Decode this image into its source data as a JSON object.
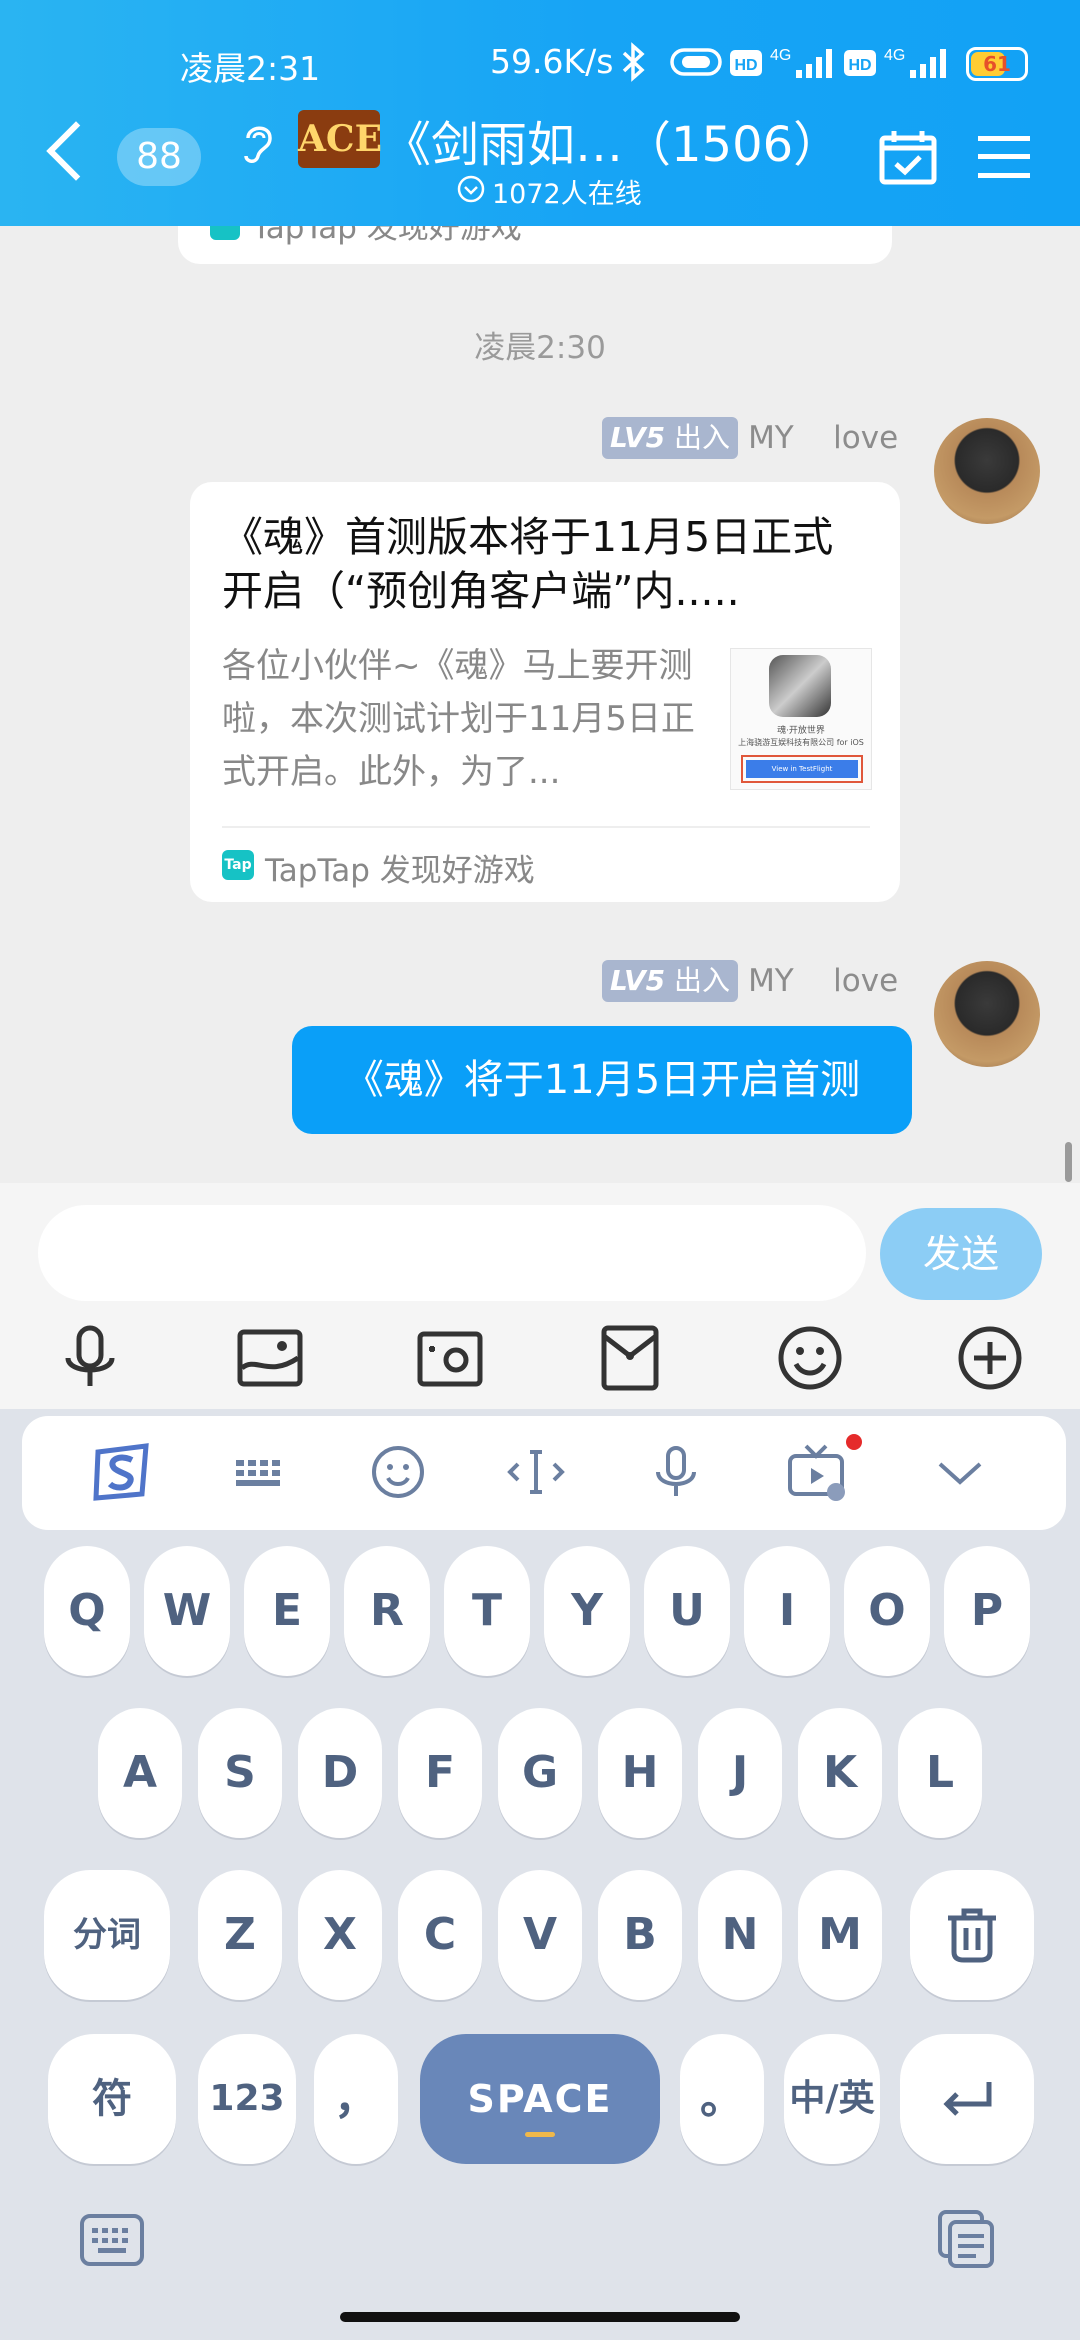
{
  "status_bar": {
    "time": "凌晨2:31",
    "network_speed": "59.6K/s",
    "battery": "61"
  },
  "header": {
    "back_count": "88",
    "group_logo": "ACE",
    "title": "《剑雨如…（1506）",
    "online": "1072人在线"
  },
  "chat": {
    "prev_card_source": "TapTap 发现好游戏",
    "timestamp": "凌晨2:30",
    "messages": [
      {
        "level": "LV5",
        "rank": "出入",
        "sender": "MY    love",
        "card_title": "《魂》首测版本将于11月5日正式开启（“预创角客户端”内.....",
        "card_desc": "各位小伙伴~《魂》马上要开测啦，本次测试计划于11月5日正式开启。此外，为了...",
        "thumb_line1": "魂·开放世界",
        "thumb_line2": "上海骁游互娱科技有限公司 for iOS",
        "thumb_button": "View in TestFlight",
        "card_source_logo": "Tap",
        "card_source": "TapTap 发现好游戏"
      },
      {
        "level": "LV5",
        "rank": "出入",
        "sender": "MY    love",
        "text": "《魂》将于11月5日开启首测"
      }
    ]
  },
  "input": {
    "placeholder": "",
    "send_label": "发送"
  },
  "keyboard": {
    "row1": [
      "Q",
      "W",
      "E",
      "R",
      "T",
      "Y",
      "U",
      "I",
      "O",
      "P"
    ],
    "row2": [
      "A",
      "S",
      "D",
      "F",
      "G",
      "H",
      "J",
      "K",
      "L"
    ],
    "row3": [
      "分词",
      "Z",
      "X",
      "C",
      "V",
      "B",
      "N",
      "M"
    ],
    "row4": {
      "symbols": "符",
      "numbers": "123",
      "comma": "，",
      "space": "SPACE",
      "period": "。",
      "lang": "中/英"
    }
  },
  "colors": {
    "header": "#17a4f5",
    "bubble": "#0a9ff8",
    "send": "#8ccdf5",
    "space_key": "#6987b9"
  }
}
